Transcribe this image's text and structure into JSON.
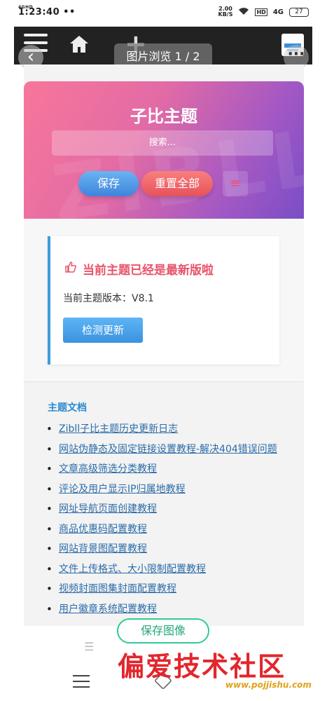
{
  "status_bar": {
    "network": "4GHD",
    "time": "1:23:40",
    "dots": "••",
    "speed_value": "2.00",
    "speed_unit": "KB/S",
    "signal_label": "4G",
    "battery": "27"
  },
  "viewer": {
    "title": "图片浏览 1 / 2",
    "back_icon": "chevron-left-icon",
    "more_icon": "more-icon"
  },
  "app_bar": {
    "menu_icon": "hamburger-icon",
    "home_icon": "home-icon",
    "add_icon": "plus-icon"
  },
  "hero": {
    "title": "子比主题",
    "watermark": "ZIBLL",
    "search_placeholder": "搜索...",
    "save_label": "保存",
    "reset_label": "重置全部",
    "list_icon": "≡"
  },
  "update_card": {
    "title": "当前主题已经是最新版啦",
    "version_text": "当前主题版本：V8.1",
    "check_button": "检测更新"
  },
  "docs": {
    "title": "主题文档",
    "items": [
      "Zibll子比主题历史更新日志",
      "网站伪静态及固定链接设置教程-解决404错误问题",
      "文章高级筛选分类教程",
      "评论及用户显示IP归属地教程",
      "网址导航页面创建教程",
      "商品优惠码配置教程",
      "网站背景图配置教程",
      "文件上传格式、大小限制配置教程",
      "视频封面图集封面配置教程",
      "用户徽章系统配置教程"
    ]
  },
  "bottom": {
    "save_image": "保存图像",
    "watermark_site": "偏爱技术社区",
    "watermark_url": "www.pojjishu.com"
  },
  "colors": {
    "accent_blue": "#3d9dd9",
    "accent_red": "#e8546a",
    "save_green": "#2fcc92"
  }
}
